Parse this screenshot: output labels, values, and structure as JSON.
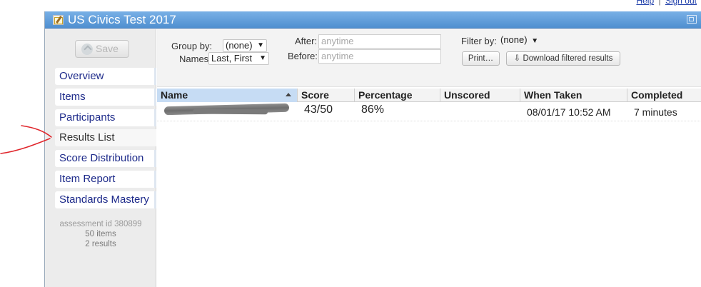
{
  "top_links": [
    "Help",
    "Sign out"
  ],
  "window": {
    "title": "US Civics Test 2017"
  },
  "sidebar": {
    "save_label": "Save",
    "nav": [
      {
        "label": "Overview"
      },
      {
        "label": "Items"
      },
      {
        "label": "Participants"
      },
      {
        "label": "Results List",
        "active": true
      },
      {
        "label": "Score Distribution"
      },
      {
        "label": "Item Report"
      },
      {
        "label": "Standards Mastery"
      }
    ],
    "meta": {
      "assessment_id": "assessment id 380899",
      "items_count": "50 items",
      "results_count": "2 results"
    }
  },
  "filters": {
    "group_by_label": "Group by:",
    "group_by_value": "(none)",
    "names_label": "Names:",
    "names_value": "Last, First",
    "after_label": "After:",
    "after_placeholder": "anytime",
    "before_label": "Before:",
    "before_placeholder": "anytime",
    "filter_by_label": "Filter by:",
    "filter_by_value": "(none)",
    "print_label": "Print…",
    "download_label": "⇩ Download filtered results"
  },
  "table": {
    "columns": [
      "Name",
      "Score",
      "Percentage",
      "Unscored",
      "When Taken",
      "Completed"
    ],
    "sorted_column": "Name",
    "rows": [
      {
        "name": "",
        "score": "43/50",
        "percentage": "86%",
        "unscored": "",
        "when_taken": "08/01/17 10:52 AM",
        "completed": "7 minutes"
      }
    ]
  },
  "colors": {
    "titlebar": "#5a97d6",
    "nav_link": "#1d2a8a",
    "annotation": "#e0262c",
    "sorted_header": "#c6dcf4"
  }
}
